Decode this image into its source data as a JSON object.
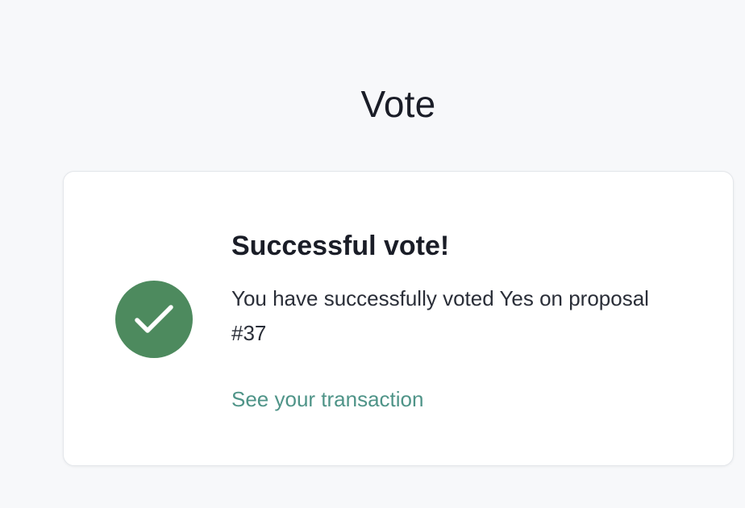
{
  "page": {
    "title": "Vote"
  },
  "result": {
    "icon": "checkmark-circle-icon",
    "icon_color": "#4d8a5e",
    "title": "Successful vote!",
    "message": "You have successfully voted Yes on proposal #37",
    "link_label": "See your transaction",
    "link_color": "#4f9488"
  }
}
